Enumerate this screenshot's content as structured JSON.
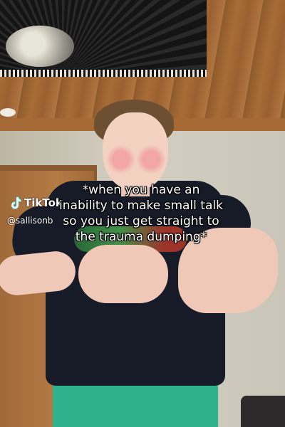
{
  "overlay": {
    "caption_lines": [
      "*when you have an",
      "inability to make small talk",
      "so you just get straight to",
      "the trauma dumping*"
    ],
    "watermark_brand": "TikTok",
    "watermark_handle": "@sallisonb",
    "brand_icon": "tiktok-logo-icon"
  }
}
